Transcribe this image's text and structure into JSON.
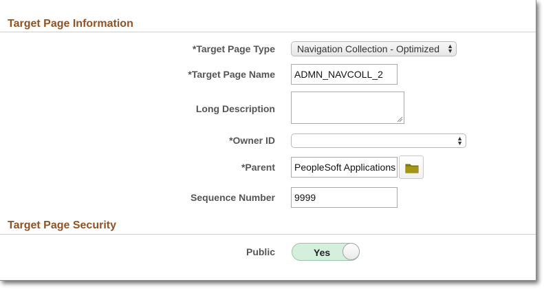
{
  "sections": {
    "info_title": "Target Page Information",
    "security_title": "Target Page Security"
  },
  "fields": {
    "page_type": {
      "label": "*Target Page Type",
      "value": "Navigation Collection - Optimized"
    },
    "page_name": {
      "label": "*Target Page Name",
      "value": "ADMN_NAVCOLL_2"
    },
    "long_description": {
      "label": "Long Description",
      "value": ""
    },
    "owner_id": {
      "label": "*Owner ID",
      "value": ""
    },
    "parent": {
      "label": "*Parent",
      "value": "PeopleSoft Applications"
    },
    "sequence_number": {
      "label": "Sequence Number",
      "value": "9999"
    }
  },
  "security": {
    "public_label": "Public",
    "public_value": "Yes",
    "toggle_color": "#d3f0dc"
  },
  "icons": {
    "lookup": "folder-icon",
    "dropdown": "updown-arrows-icon"
  },
  "colors": {
    "section_title": "#94501f",
    "label": "#555555"
  }
}
